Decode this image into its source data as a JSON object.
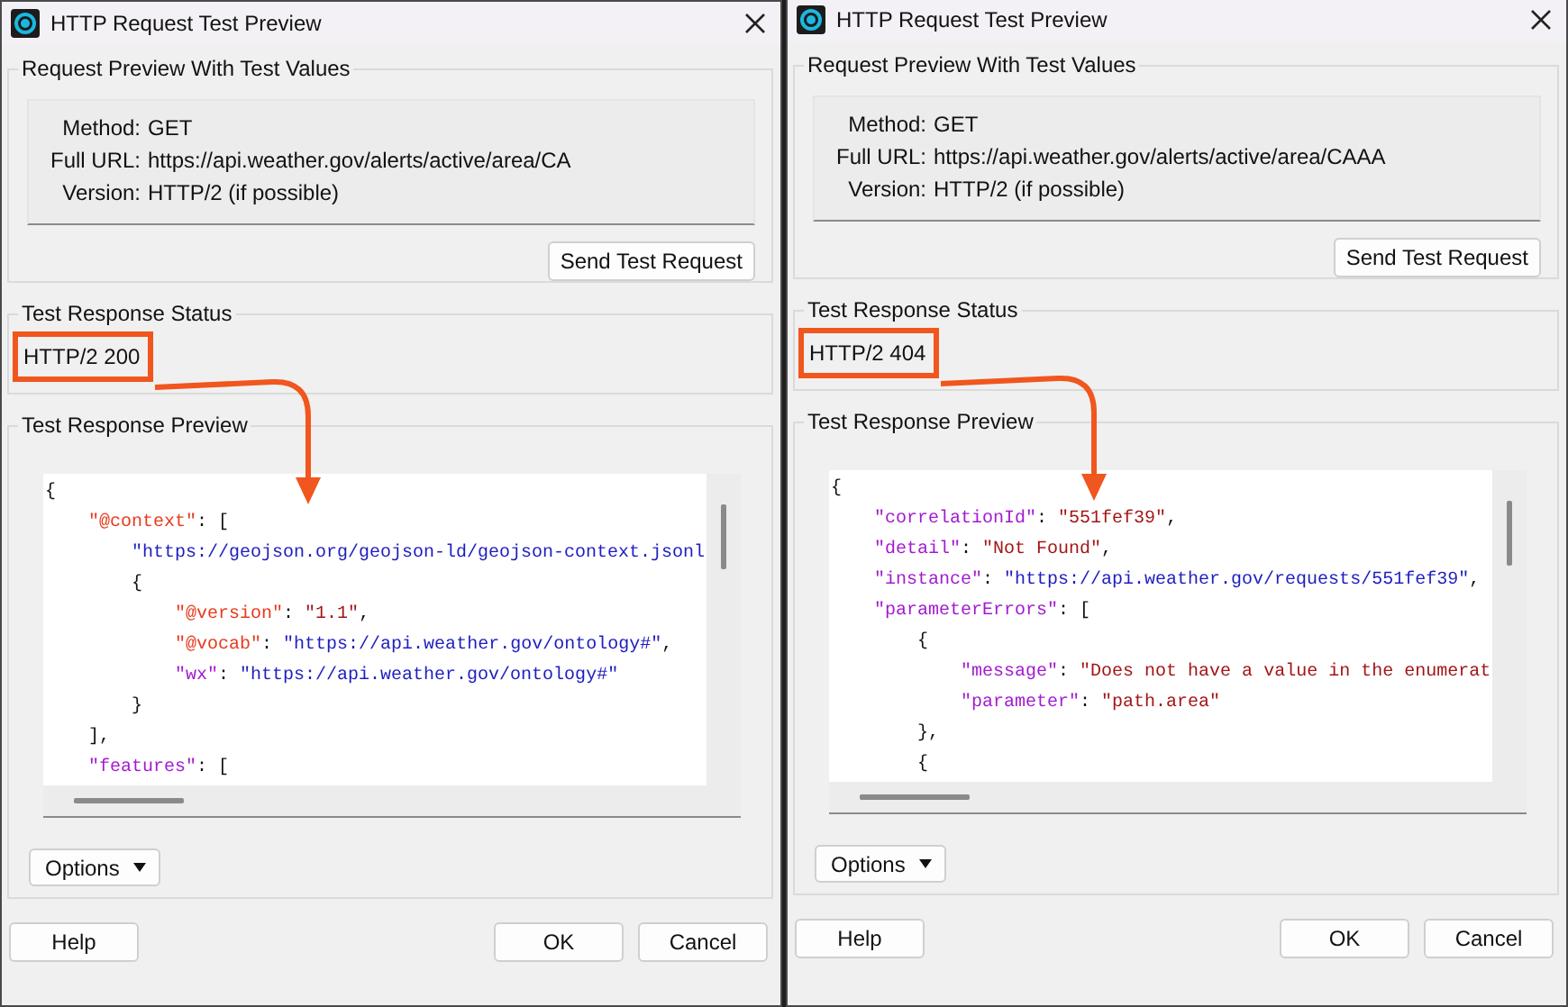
{
  "windows": [
    {
      "title": "HTTP Request Test Preview",
      "request_preview": {
        "title": "Request Preview With Test Values",
        "fields": [
          {
            "label": "Method:",
            "value": "GET"
          },
          {
            "label": "Full URL:",
            "value": "https://api.weather.gov/alerts/active/area/CA"
          },
          {
            "label": "Version:",
            "value": "HTTP/2 (if possible)"
          }
        ],
        "send_button": "Send Test Request"
      },
      "response_status": {
        "title": "Test Response Status",
        "text": "HTTP/2 200"
      },
      "response_preview": {
        "title": "Test Response Preview",
        "lines": [
          [
            {
              "kind": "punct",
              "text": "{"
            }
          ],
          [
            {
              "kind": "special_key",
              "text": "    \"@context\""
            },
            {
              "kind": "punct",
              "text": ": ["
            }
          ],
          [
            {
              "kind": "url",
              "text": "        \"https://geojson.org/geojson-ld/geojson-context.jsonl"
            }
          ],
          [
            {
              "kind": "punct",
              "text": "        {"
            }
          ],
          [
            {
              "kind": "special_key",
              "text": "            \"@version\""
            },
            {
              "kind": "punct",
              "text": ": "
            },
            {
              "kind": "string",
              "text": "\"1.1\""
            },
            {
              "kind": "punct",
              "text": ","
            }
          ],
          [
            {
              "kind": "special_key",
              "text": "            \"@vocab\""
            },
            {
              "kind": "punct",
              "text": ": "
            },
            {
              "kind": "url",
              "text": "\"https://api.weather.gov/ontology#\""
            },
            {
              "kind": "punct",
              "text": ","
            }
          ],
          [
            {
              "kind": "key",
              "text": "            \"wx\""
            },
            {
              "kind": "punct",
              "text": ": "
            },
            {
              "kind": "url",
              "text": "\"https://api.weather.gov/ontology#\""
            }
          ],
          [
            {
              "kind": "punct",
              "text": "        }"
            }
          ],
          [
            {
              "kind": "punct",
              "text": "    ],"
            }
          ],
          [
            {
              "kind": "key",
              "text": "    \"features\""
            },
            {
              "kind": "punct",
              "text": ": ["
            }
          ]
        ],
        "options_button": "Options"
      },
      "buttons": [
        "Help",
        "OK",
        "Cancel"
      ]
    },
    {
      "title": "HTTP Request Test Preview",
      "request_preview": {
        "title": "Request Preview With Test Values",
        "fields": [
          {
            "label": "Method:",
            "value": "GET"
          },
          {
            "label": "Full URL:",
            "value": "https://api.weather.gov/alerts/active/area/CAAA"
          },
          {
            "label": "Version:",
            "value": "HTTP/2 (if possible)"
          }
        ],
        "send_button": "Send Test Request"
      },
      "response_status": {
        "title": "Test Response Status",
        "text": "HTTP/2 404"
      },
      "response_preview": {
        "title": "Test Response Preview",
        "lines": [
          [
            {
              "kind": "punct",
              "text": "{"
            }
          ],
          [
            {
              "kind": "key",
              "text": "    \"correlationId\""
            },
            {
              "kind": "punct",
              "text": ": "
            },
            {
              "kind": "string",
              "text": "\"551fef39\""
            },
            {
              "kind": "punct",
              "text": ","
            }
          ],
          [
            {
              "kind": "key",
              "text": "    \"detail\""
            },
            {
              "kind": "punct",
              "text": ": "
            },
            {
              "kind": "string",
              "text": "\"Not Found\""
            },
            {
              "kind": "punct",
              "text": ","
            }
          ],
          [
            {
              "kind": "key",
              "text": "    \"instance\""
            },
            {
              "kind": "punct",
              "text": ": "
            },
            {
              "kind": "url",
              "text": "\"https://api.weather.gov/requests/551fef39\""
            },
            {
              "kind": "punct",
              "text": ","
            }
          ],
          [
            {
              "kind": "key",
              "text": "    \"parameterErrors\""
            },
            {
              "kind": "punct",
              "text": ": ["
            }
          ],
          [
            {
              "kind": "punct",
              "text": "        {"
            }
          ],
          [
            {
              "kind": "key",
              "text": "            \"message\""
            },
            {
              "kind": "punct",
              "text": ": "
            },
            {
              "kind": "string",
              "text": "\"Does not have a value in the enumerat"
            }
          ],
          [
            {
              "kind": "key",
              "text": "            \"parameter\""
            },
            {
              "kind": "punct",
              "text": ": "
            },
            {
              "kind": "string",
              "text": "\"path.area\""
            }
          ],
          [
            {
              "kind": "punct",
              "text": "        },"
            }
          ],
          [
            {
              "kind": "punct",
              "text": "        {"
            }
          ]
        ],
        "options_button": "Options"
      },
      "buttons": [
        "Help",
        "OK",
        "Cancel"
      ]
    }
  ]
}
